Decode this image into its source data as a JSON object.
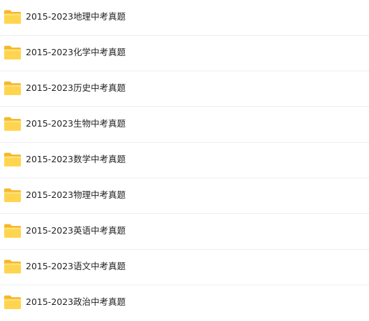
{
  "files": [
    {
      "name": "2015-2023地理中考真题",
      "icon": "folder-icon"
    },
    {
      "name": "2015-2023化学中考真题",
      "icon": "folder-icon"
    },
    {
      "name": "2015-2023历史中考真题",
      "icon": "folder-icon"
    },
    {
      "name": "2015-2023生物中考真题",
      "icon": "folder-icon"
    },
    {
      "name": "2015-2023数学中考真题",
      "icon": "folder-icon"
    },
    {
      "name": "2015-2023物理中考真题",
      "icon": "folder-icon"
    },
    {
      "name": "2015-2023英语中考真题",
      "icon": "folder-icon"
    },
    {
      "name": "2015-2023语文中考真题",
      "icon": "folder-icon"
    },
    {
      "name": "2015-2023政治中考真题",
      "icon": "folder-icon"
    }
  ],
  "colors": {
    "folder_back": "#f5b72a",
    "folder_front": "#ffd54f",
    "folder_front_light": "#ffe07a",
    "divider": "#eeeeee",
    "text": "#222222"
  }
}
